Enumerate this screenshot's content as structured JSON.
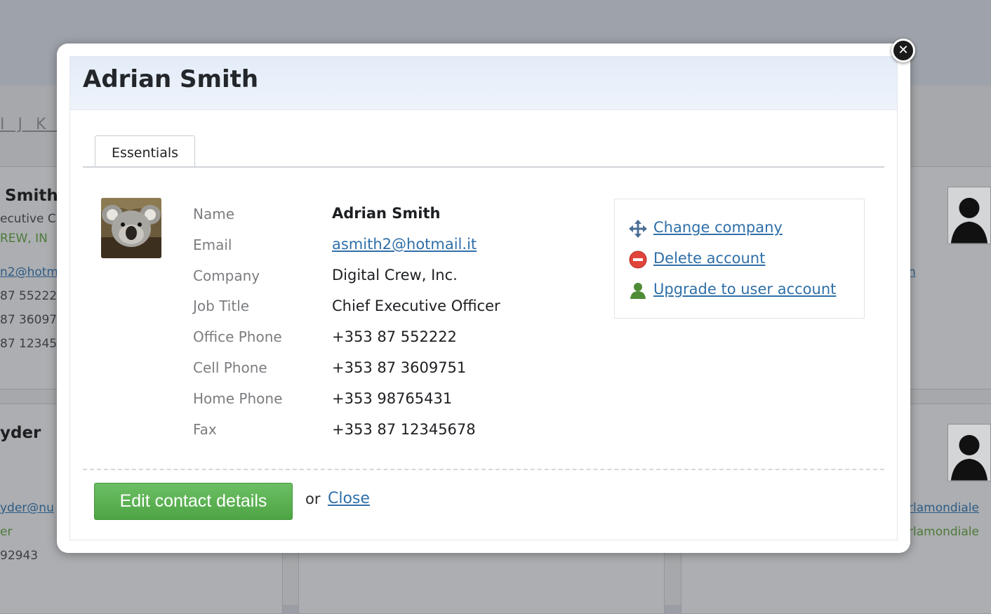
{
  "background": {
    "alphabet_letters": "I J K L",
    "cards": [
      {
        "name": "Smith",
        "lines": [
          "ecutive C",
          "REW, IN",
          "n2@hotm",
          "87 55222",
          "87 36097",
          "87 12345"
        ]
      },
      {
        "name": "yder",
        "lines": [
          "yder@nu",
          "er",
          "92943"
        ]
      }
    ],
    "right_links": [
      "n",
      "rlamondiale",
      "rlamondiale"
    ]
  },
  "modal": {
    "title": "Adrian Smith",
    "close_icon": "close-x-icon",
    "tabs": [
      {
        "label": "Essentials",
        "active": true
      }
    ],
    "avatar_icon": "koala-photo",
    "fields": [
      {
        "label": "Name",
        "value": "Adrian Smith"
      },
      {
        "label": "Email",
        "value": "asmith2@hotmail.it"
      },
      {
        "label": "Company",
        "value": "Digital Crew, Inc."
      },
      {
        "label": "Job Title",
        "value": "Chief Executive Officer"
      },
      {
        "label": "Office Phone",
        "value": "+353 87 552222"
      },
      {
        "label": "Cell Phone",
        "value": "+353 87 3609751"
      },
      {
        "label": "Home Phone",
        "value": "+353 98765431"
      },
      {
        "label": "Fax",
        "value": "+353 87 12345678"
      }
    ],
    "actions": [
      {
        "label": "Change company",
        "icon": "move-arrows-icon"
      },
      {
        "label": "Delete account",
        "icon": "minus-circle-icon"
      },
      {
        "label": "Upgrade to user account",
        "icon": "user-icon"
      }
    ],
    "footer": {
      "edit_button": "Edit contact details",
      "or_text": "or",
      "close_link": "Close"
    }
  },
  "colors": {
    "link": "#2f6fa8",
    "button_green": "#5cb352",
    "title_bar": "#e8eff9",
    "overlay": "#9a9da3"
  }
}
